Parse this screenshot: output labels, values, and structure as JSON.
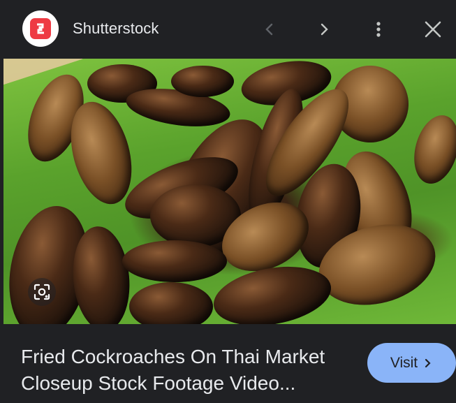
{
  "header": {
    "source_name": "Shutterstock",
    "icons": {
      "logo": "shutterstock-logo-icon",
      "prev": "chevron-left-icon",
      "next": "chevron-right-icon",
      "more": "more-vert-icon",
      "close": "close-icon"
    }
  },
  "image": {
    "lens_icon": "google-lens-icon"
  },
  "result": {
    "title_line1": "Fried Cockroaches On Thai Market",
    "title_line2": "Closeup Stock Footage Video...",
    "visit_label": "Visit"
  },
  "colors": {
    "background": "#202124",
    "text": "#e8eaed",
    "visit_button": "#8ab4f8",
    "brand": "#ee3a43"
  }
}
